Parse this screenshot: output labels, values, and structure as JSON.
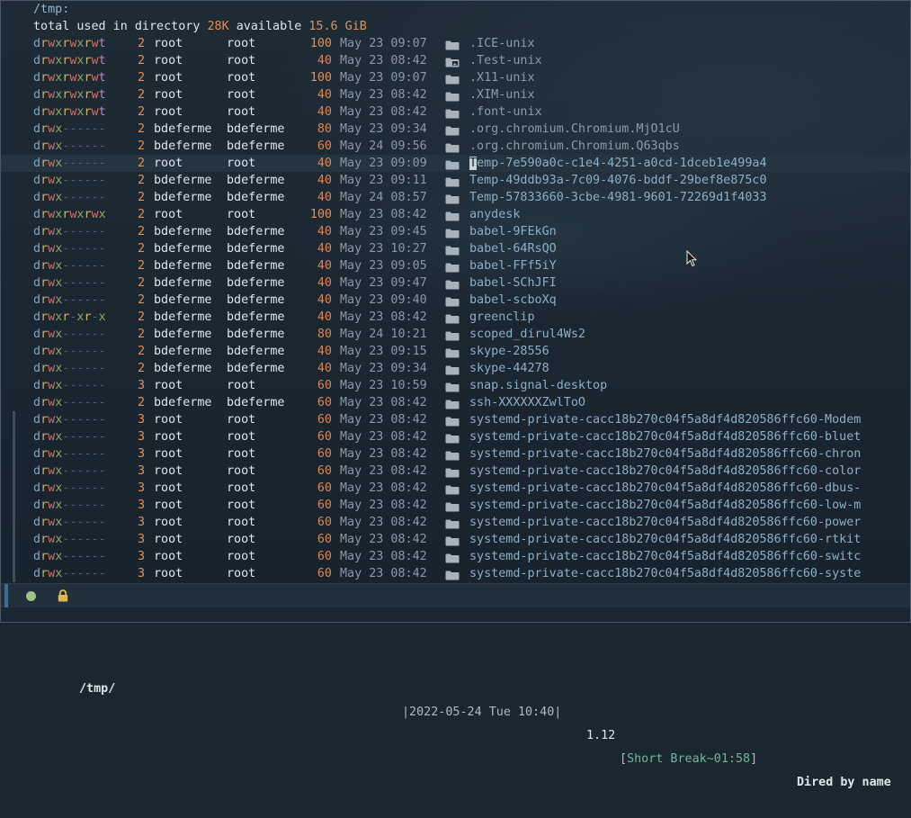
{
  "header": {
    "directory": "/tmp:",
    "total_prefix": "total used in directory ",
    "total_used": "28K",
    "available_label": " available ",
    "available": "15.6 GiB"
  },
  "colors": {
    "accent": "#8eaec6",
    "number": "#e0925a",
    "cursor_row": "#253441",
    "status_green": "#9cc58a"
  },
  "entries": [
    {
      "perm": "drwxrwxrwt",
      "links": "2",
      "owner": "root",
      "group": "root",
      "size": "100",
      "date": "May 23 09:07",
      "name": ".ICE-unix",
      "icon": "folder-icon"
    },
    {
      "perm": "drwxrwxrwt",
      "links": "2",
      "owner": "root",
      "group": "root",
      "size": "40",
      "date": "May 23 08:42",
      "name": ".Test-unix",
      "icon": "folder-image-icon"
    },
    {
      "perm": "drwxrwxrwt",
      "links": "2",
      "owner": "root",
      "group": "root",
      "size": "100",
      "date": "May 23 09:07",
      "name": ".X11-unix",
      "icon": "folder-icon"
    },
    {
      "perm": "drwxrwxrwt",
      "links": "2",
      "owner": "root",
      "group": "root",
      "size": "40",
      "date": "May 23 08:42",
      "name": ".XIM-unix",
      "icon": "folder-icon"
    },
    {
      "perm": "drwxrwxrwt",
      "links": "2",
      "owner": "root",
      "group": "root",
      "size": "40",
      "date": "May 23 08:42",
      "name": ".font-unix",
      "icon": "folder-icon"
    },
    {
      "perm": "drwx------",
      "links": "2",
      "owner": "bdeferme",
      "group": "bdeferme",
      "size": "80",
      "date": "May 23 09:34",
      "name": ".org.chromium.Chromium.MjO1cU",
      "icon": "folder-icon"
    },
    {
      "perm": "drwx------",
      "links": "2",
      "owner": "bdeferme",
      "group": "bdeferme",
      "size": "60",
      "date": "May 24 09:56",
      "name": ".org.chromium.Chromium.Q63qbs",
      "icon": "folder-icon"
    },
    {
      "perm": "drwx------",
      "links": "2",
      "owner": "root",
      "group": "root",
      "size": "40",
      "date": "May 23 09:09",
      "name": "Temp-7e590a0c-c1e4-4251-a0cd-1dceb1e499a4",
      "icon": "folder-icon",
      "current": true
    },
    {
      "perm": "drwx------",
      "links": "2",
      "owner": "bdeferme",
      "group": "bdeferme",
      "size": "40",
      "date": "May 23 09:11",
      "name": "Temp-49ddb93a-7c09-4076-bddf-29bef8e875c0",
      "icon": "folder-icon"
    },
    {
      "perm": "drwx------",
      "links": "2",
      "owner": "bdeferme",
      "group": "bdeferme",
      "size": "40",
      "date": "May 24 08:57",
      "name": "Temp-57833660-3cbe-4981-9601-72269d1f4033",
      "icon": "folder-icon"
    },
    {
      "perm": "drwxrwxrwx",
      "links": "2",
      "owner": "root",
      "group": "root",
      "size": "100",
      "date": "May 23 08:42",
      "name": "anydesk",
      "icon": "folder-icon"
    },
    {
      "perm": "drwx------",
      "links": "2",
      "owner": "bdeferme",
      "group": "bdeferme",
      "size": "40",
      "date": "May 23 09:45",
      "name": "babel-9FEkGn",
      "icon": "folder-icon"
    },
    {
      "perm": "drwx------",
      "links": "2",
      "owner": "bdeferme",
      "group": "bdeferme",
      "size": "40",
      "date": "May 23 10:27",
      "name": "babel-64RsQO",
      "icon": "folder-icon"
    },
    {
      "perm": "drwx------",
      "links": "2",
      "owner": "bdeferme",
      "group": "bdeferme",
      "size": "40",
      "date": "May 23 09:05",
      "name": "babel-FFf5iY",
      "icon": "folder-icon"
    },
    {
      "perm": "drwx------",
      "links": "2",
      "owner": "bdeferme",
      "group": "bdeferme",
      "size": "40",
      "date": "May 23 09:47",
      "name": "babel-SChJFI",
      "icon": "folder-icon"
    },
    {
      "perm": "drwx------",
      "links": "2",
      "owner": "bdeferme",
      "group": "bdeferme",
      "size": "40",
      "date": "May 23 09:40",
      "name": "babel-scboXq",
      "icon": "folder-icon"
    },
    {
      "perm": "drwxr-xr-x",
      "links": "2",
      "owner": "bdeferme",
      "group": "bdeferme",
      "size": "40",
      "date": "May 23 08:42",
      "name": "greenclip",
      "icon": "folder-icon"
    },
    {
      "perm": "drwx------",
      "links": "2",
      "owner": "bdeferme",
      "group": "bdeferme",
      "size": "80",
      "date": "May 24 10:21",
      "name": "scoped_dirul4Ws2",
      "icon": "folder-icon"
    },
    {
      "perm": "drwx------",
      "links": "2",
      "owner": "bdeferme",
      "group": "bdeferme",
      "size": "40",
      "date": "May 23 09:15",
      "name": "skype-28556",
      "icon": "folder-icon"
    },
    {
      "perm": "drwx------",
      "links": "2",
      "owner": "bdeferme",
      "group": "bdeferme",
      "size": "40",
      "date": "May 23 09:34",
      "name": "skype-44278",
      "icon": "folder-icon"
    },
    {
      "perm": "drwx------",
      "links": "3",
      "owner": "root",
      "group": "root",
      "size": "60",
      "date": "May 23 10:59",
      "name": "snap.signal-desktop",
      "icon": "folder-icon"
    },
    {
      "perm": "drwx------",
      "links": "2",
      "owner": "bdeferme",
      "group": "bdeferme",
      "size": "60",
      "date": "May 23 08:42",
      "name": "ssh-XXXXXXZwlToO",
      "icon": "folder-icon"
    },
    {
      "perm": "drwx------",
      "links": "3",
      "owner": "root",
      "group": "root",
      "size": "60",
      "date": "May 23 08:42",
      "name": "systemd-private-cacc18b270c04f5a8df4d820586ffc60-Modem",
      "icon": "folder-icon",
      "fringe": true
    },
    {
      "perm": "drwx------",
      "links": "3",
      "owner": "root",
      "group": "root",
      "size": "60",
      "date": "May 23 08:42",
      "name": "systemd-private-cacc18b270c04f5a8df4d820586ffc60-bluet",
      "icon": "folder-icon",
      "fringe": true
    },
    {
      "perm": "drwx------",
      "links": "3",
      "owner": "root",
      "group": "root",
      "size": "60",
      "date": "May 23 08:42",
      "name": "systemd-private-cacc18b270c04f5a8df4d820586ffc60-chron",
      "icon": "folder-icon",
      "fringe": true
    },
    {
      "perm": "drwx------",
      "links": "3",
      "owner": "root",
      "group": "root",
      "size": "60",
      "date": "May 23 08:42",
      "name": "systemd-private-cacc18b270c04f5a8df4d820586ffc60-color",
      "icon": "folder-icon",
      "fringe": true
    },
    {
      "perm": "drwx------",
      "links": "3",
      "owner": "root",
      "group": "root",
      "size": "60",
      "date": "May 23 08:42",
      "name": "systemd-private-cacc18b270c04f5a8df4d820586ffc60-dbus-",
      "icon": "folder-icon",
      "fringe": true
    },
    {
      "perm": "drwx------",
      "links": "3",
      "owner": "root",
      "group": "root",
      "size": "60",
      "date": "May 23 08:42",
      "name": "systemd-private-cacc18b270c04f5a8df4d820586ffc60-low-m",
      "icon": "folder-icon",
      "fringe": true
    },
    {
      "perm": "drwx------",
      "links": "3",
      "owner": "root",
      "group": "root",
      "size": "60",
      "date": "May 23 08:42",
      "name": "systemd-private-cacc18b270c04f5a8df4d820586ffc60-power",
      "icon": "folder-icon",
      "fringe": true
    },
    {
      "perm": "drwx------",
      "links": "3",
      "owner": "root",
      "group": "root",
      "size": "60",
      "date": "May 23 08:42",
      "name": "systemd-private-cacc18b270c04f5a8df4d820586ffc60-rtkit",
      "icon": "folder-icon",
      "fringe": true
    },
    {
      "perm": "drwx------",
      "links": "3",
      "owner": "root",
      "group": "root",
      "size": "60",
      "date": "May 23 08:42",
      "name": "systemd-private-cacc18b270c04f5a8df4d820586ffc60-switc",
      "icon": "folder-icon",
      "fringe": true
    },
    {
      "perm": "drwx------",
      "links": "3",
      "owner": "root",
      "group": "root",
      "size": "60",
      "date": "May 23 08:42",
      "name": "systemd-private-cacc18b270c04f5a8df4d820586ffc60-syste",
      "icon": "folder-icon",
      "fringe": true
    }
  ],
  "modeline": {
    "path": "/tmp/",
    "datetime": "|2022-05-24 Tue 10:40|",
    "version": "1.12",
    "break_open": "[",
    "break_text": "Short Break~01:58",
    "break_close": "]",
    "mode": "Dired by name",
    "lock_icon": "lock-icon",
    "status_icon": "status-dot-icon"
  }
}
